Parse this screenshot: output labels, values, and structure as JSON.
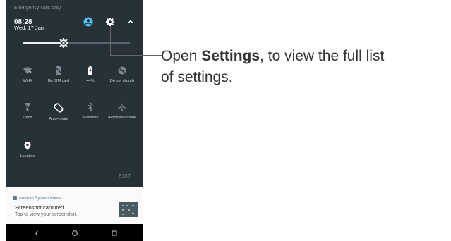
{
  "status": {
    "emergency": "Emergency calls only"
  },
  "header": {
    "time": "08:28",
    "date": "Wed, 17 Jan",
    "icons": [
      "account-icon",
      "settings-gear-icon",
      "chevron-up-icon"
    ]
  },
  "brightness": {
    "level": 0.38
  },
  "tiles": [
    {
      "label": "Wi-Fi",
      "icon": "wifi-icon"
    },
    {
      "label": "No SIM card",
      "icon": "no-sim-icon"
    },
    {
      "label": "44%",
      "icon": "battery-icon"
    },
    {
      "label": "Do not disturb",
      "icon": "do-not-disturb-icon"
    },
    {
      "label": "Torch",
      "icon": "torch-icon"
    },
    {
      "label": "Auto-rotate",
      "icon": "auto-rotate-icon"
    },
    {
      "label": "Bluetooth",
      "icon": "bluetooth-icon"
    },
    {
      "label": "Aeroplane mode",
      "icon": "aeroplane-icon"
    },
    {
      "label": "Location",
      "icon": "location-icon"
    }
  ],
  "edit_label": "EDIT",
  "notification": {
    "app": "Android System",
    "meta": " • now ⌄",
    "title": "Screenshot captured.",
    "text": "Tap to view your screenshot."
  },
  "nav": {
    "icons": [
      "back-icon",
      "home-icon",
      "recents-icon"
    ]
  },
  "callout": {
    "prefix": "Open ",
    "emphasis": "Settings",
    "suffix": ", to view the full list",
    "line2": "of settings."
  },
  "colors": {
    "panel": "#263238",
    "icon": "#ffffff",
    "dim_icon": "#7b8a90",
    "account": "#4fc3f7"
  }
}
